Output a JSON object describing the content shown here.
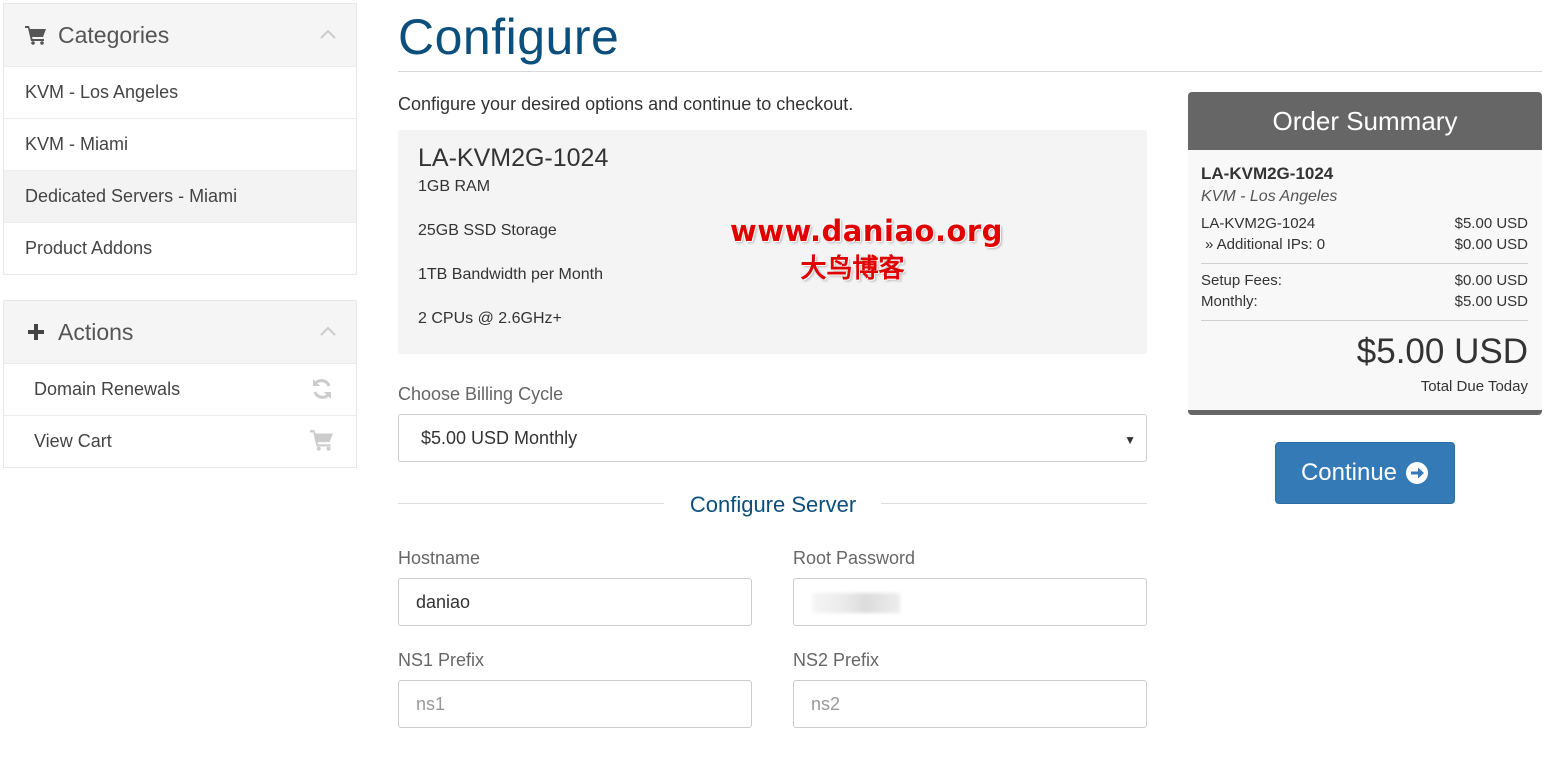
{
  "sidebar": {
    "categories": {
      "title": "Categories",
      "icon": "cart-icon",
      "items": [
        {
          "label": "KVM - Los Angeles",
          "active": false
        },
        {
          "label": "KVM - Miami",
          "active": false
        },
        {
          "label": "Dedicated Servers - Miami",
          "active": true
        },
        {
          "label": "Product Addons",
          "active": false
        }
      ]
    },
    "actions": {
      "title": "Actions",
      "icon": "plus-icon",
      "items": [
        {
          "label": "Domain Renewals",
          "icon": "refresh-icon"
        },
        {
          "label": "View Cart",
          "icon": "cart-icon"
        }
      ]
    }
  },
  "main": {
    "title": "Configure",
    "intro": "Configure your desired options and continue to checkout.",
    "product": {
      "name": "LA-KVM2G-1024",
      "features": [
        "1GB RAM",
        "25GB SSD Storage",
        "1TB Bandwidth per Month",
        "2 CPUs @ 2.6GHz+"
      ]
    },
    "watermark": {
      "line1": "www.daniao.org",
      "line2": "大鸟博客"
    },
    "billing": {
      "label": "Choose Billing Cycle",
      "selected": "$5.00 USD Monthly"
    },
    "configure_server": {
      "title": "Configure Server",
      "hostname": {
        "label": "Hostname",
        "value": "daniao"
      },
      "root_password": {
        "label": "Root Password",
        "value": ""
      },
      "ns1": {
        "label": "NS1 Prefix",
        "placeholder": "ns1"
      },
      "ns2": {
        "label": "NS2 Prefix",
        "placeholder": "ns2"
      }
    }
  },
  "summary": {
    "title": "Order Summary",
    "product": "LA-KVM2G-1024",
    "category": "KVM - Los Angeles",
    "lines": [
      {
        "label": "LA-KVM2G-1024",
        "value": "$5.00 USD"
      },
      {
        "label": "» Additional IPs: 0",
        "value": "$0.00 USD"
      }
    ],
    "fees": [
      {
        "label": "Setup Fees:",
        "value": "$0.00 USD"
      },
      {
        "label": "Monthly:",
        "value": "$5.00 USD"
      }
    ],
    "total": "$5.00 USD",
    "total_label": "Total Due Today",
    "continue_label": "Continue"
  },
  "colors": {
    "accent": "#337ab7",
    "title": "#0d4f7c",
    "summary_head": "#666666",
    "watermark": "#e00000"
  }
}
